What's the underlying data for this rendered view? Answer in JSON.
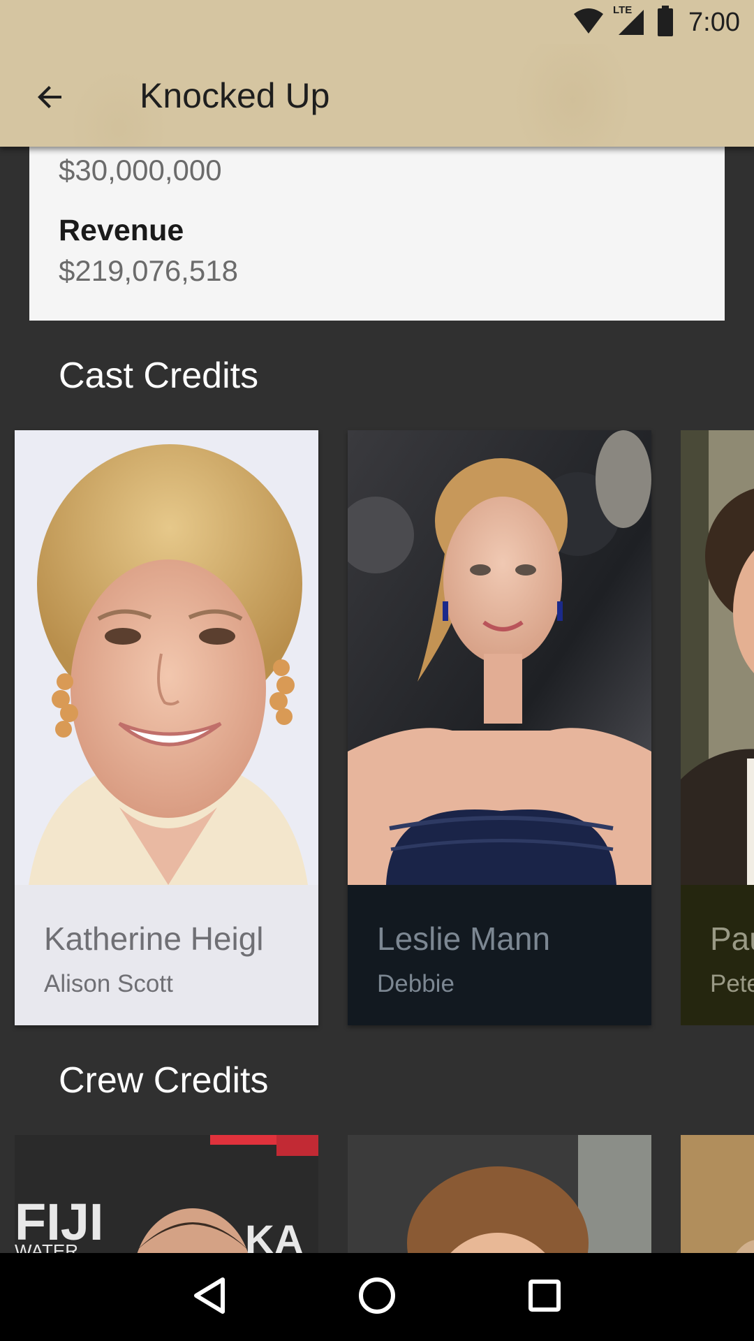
{
  "status_bar": {
    "time": "7:00",
    "network": "LTE",
    "icons": [
      "wifi-icon",
      "cell-signal-icon",
      "battery-icon"
    ]
  },
  "toolbar": {
    "back_icon": "arrow-back-icon",
    "title": "Knocked Up"
  },
  "info": {
    "budget_value": "$30,000,000",
    "revenue_label": "Revenue",
    "revenue_value": "$219,076,518"
  },
  "cast": {
    "title": "Cast Credits",
    "items": [
      {
        "name": "Katherine Heigl",
        "role": "Alison Scott",
        "caption_bg": "#e8e8ee",
        "text_color": "#6f6f74"
      },
      {
        "name": "Leslie Mann",
        "role": "Debbie",
        "caption_bg": "#121920",
        "text_color": "#7c8792"
      },
      {
        "name": "Pau",
        "role": "Pete",
        "caption_bg": "#25260f",
        "text_color": "#9a9a86"
      }
    ]
  },
  "crew": {
    "title": "Crew Credits",
    "photo_text": "FIJI WATER"
  },
  "nav": {
    "icons": [
      "back-triangle-icon",
      "home-circle-icon",
      "recents-square-icon"
    ]
  },
  "colors": {
    "toolbar": "#d5c5a1",
    "background": "#303030",
    "card": "#f5f5f5"
  }
}
